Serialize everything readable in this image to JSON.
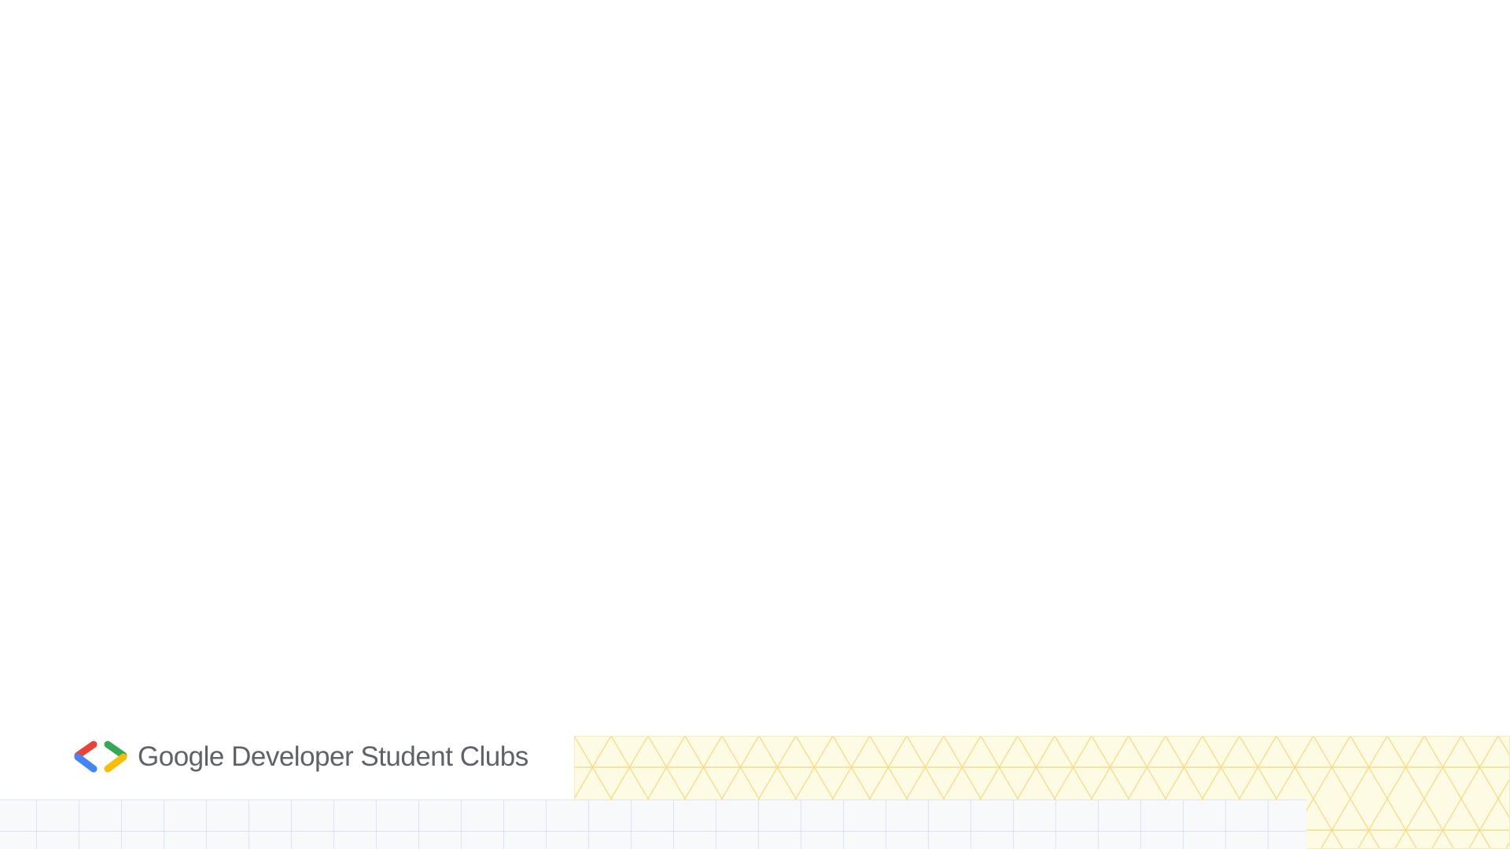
{
  "slide": {
    "brand_text": "Google Developer Student Clubs",
    "logo_icon": "gdsc-brackets-icon"
  },
  "colors": {
    "background": "#ffffff",
    "brand_text": "#5f6368",
    "logo_red": "#ea4335",
    "logo_blue": "#4285f4",
    "logo_green": "#34a853",
    "logo_yellow": "#fbbc04",
    "pattern_yellow_fill": "#fefbe4",
    "pattern_yellow_line": "#f6dd8c",
    "pattern_grid_fill": "#f8f9fa",
    "pattern_grid_line": "#c6d4f5"
  }
}
